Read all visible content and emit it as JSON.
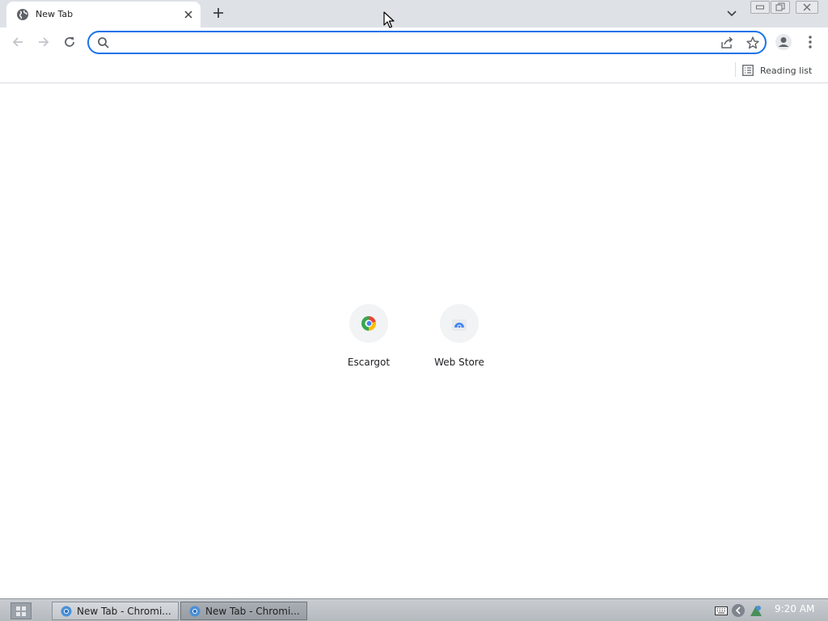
{
  "browser": {
    "tab": {
      "title": "New Tab"
    },
    "omnibox": {
      "value": "",
      "placeholder": ""
    },
    "bookmarks_bar": {
      "reading_list_label": "Reading list"
    }
  },
  "new_tab_page": {
    "shortcuts": [
      {
        "label": "Escargot",
        "icon": "escargot-icon"
      },
      {
        "label": "Web Store",
        "icon": "web-store-icon"
      }
    ]
  },
  "taskbar": {
    "tasks": [
      {
        "label": "New Tab - Chromi...",
        "active": false
      },
      {
        "label": "New Tab - Chromi...",
        "active": true
      }
    ],
    "clock": "9:20 AM"
  },
  "colors": {
    "accent": "#1a73e8",
    "tabstrip": "#dee1e6",
    "taskbar": "#b5babf"
  }
}
